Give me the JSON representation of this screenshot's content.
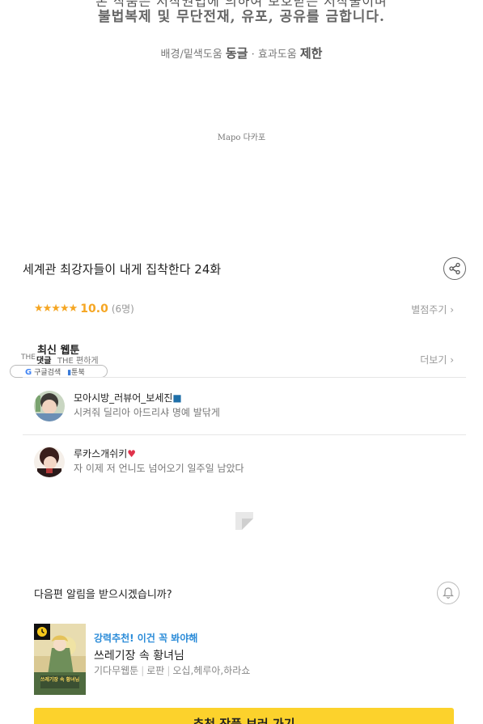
{
  "credits": {
    "line1": "본 작품은 저작권법에 의하여 보호받는 저작물이며",
    "line2": "불법복제 및 무단전재, 유포, 공유를 금합니다.",
    "assist_prefix": "배경/밑색도움",
    "assist_bg": "동글",
    "assist_dot": "·",
    "assist_effect_prefix": "효과도움",
    "assist_effect": "제한",
    "studio": "Mapo 다카포"
  },
  "episode": {
    "title": "세계관 최강자들이 내게 집착한다 24화",
    "share_icon": "share-icon"
  },
  "rating": {
    "stars": "★★★★★",
    "score": "10.0",
    "count": "(6명)",
    "rate_link": "별점주기 ›"
  },
  "latest": {
    "label": "최신 웹툰",
    "comments_label": "댓글",
    "ghost_left": "THE",
    "ghost_mid": "THE 편하게",
    "more_link": "더보기 ›"
  },
  "extension_bar": {
    "google": "구글검색",
    "book": "툰북"
  },
  "comments": [
    {
      "name": "모아시방_러뷰어_보세진",
      "name_emoji": "■",
      "text": "시켜줘 딜리아 아드리샤 명예 발닦게"
    },
    {
      "name": "루카스개쉬키",
      "name_emoji": "♥",
      "text": "자 이제 저 언니도 넘어오기 일주일 남았다"
    }
  ],
  "notify": {
    "text": "다음편 알림을 받으시겠습니까?"
  },
  "recommend": {
    "tag": "강력추천! 이건 꼭 봐야해",
    "title": "쓰레기장 속 황녀님",
    "meta": [
      "기다무웹툰",
      "로판",
      "오십,헤루아,하라쇼"
    ],
    "cover_text": "쓰레기장 속 황녀님"
  },
  "cta": {
    "label": "추천 작품 보러 가기"
  },
  "colors": {
    "star": "#f5a623",
    "tag_blue": "#2a8bd8",
    "cta_yellow": "#fcd22c"
  }
}
